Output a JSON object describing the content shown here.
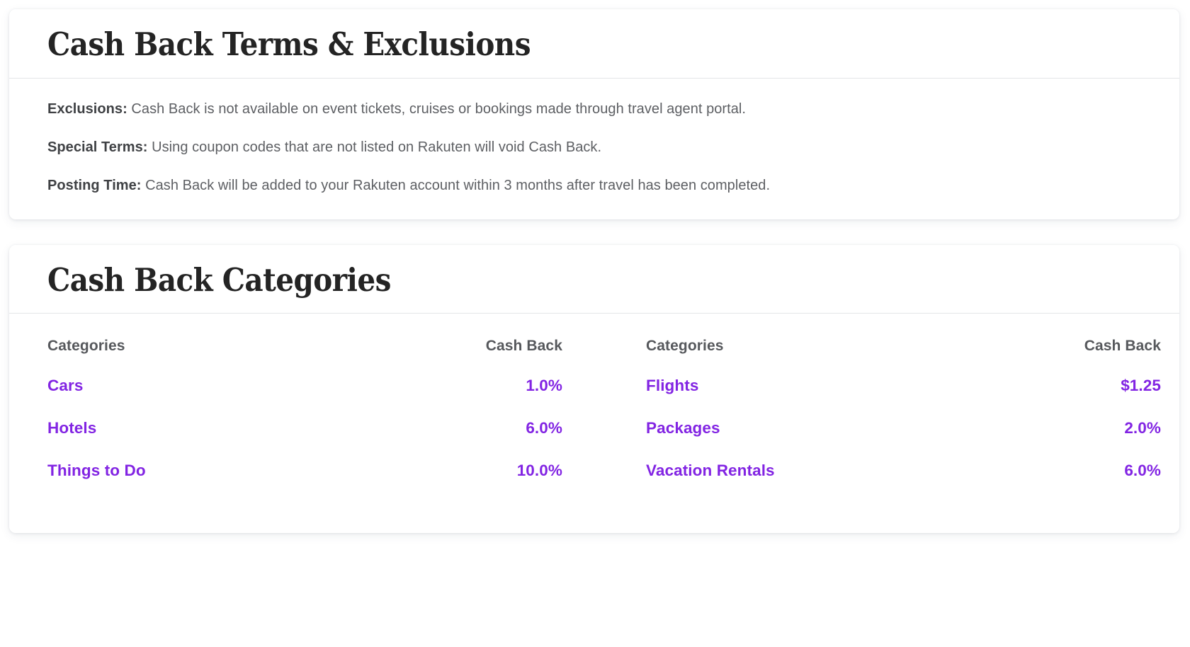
{
  "colors": {
    "accent_purple": "#8224E3",
    "heading_dark": "#242424",
    "body_gray": "#5D5F63",
    "label_gray": "#3F4144",
    "table_header_gray": "#56585C",
    "divider": "#E4E5E8",
    "card_bg": "#FFFFFF",
    "page_bg": "#FFFFFF"
  },
  "terms_card": {
    "title": "Cash Back Terms & Exclusions",
    "lines": [
      {
        "label": "Exclusions:",
        "text": " Cash Back is not available on event tickets, cruises or bookings made through travel agent portal."
      },
      {
        "label": "Special Terms:",
        "text": " Using coupon codes that are not listed on Rakuten will void Cash Back."
      },
      {
        "label": "Posting Time:",
        "text": " Cash Back will be added to your Rakuten account within 3 months after travel has been completed."
      }
    ]
  },
  "categories_card": {
    "title": "Cash Back Categories",
    "tables": [
      {
        "headers": {
          "category": "Categories",
          "cash_back": "Cash Back"
        },
        "rows": [
          {
            "category": "Cars",
            "cash_back": "1.0%"
          },
          {
            "category": "Hotels",
            "cash_back": "6.0%"
          },
          {
            "category": "Things to Do",
            "cash_back": "10.0%"
          }
        ]
      },
      {
        "headers": {
          "category": "Categories",
          "cash_back": "Cash Back"
        },
        "rows": [
          {
            "category": "Flights",
            "cash_back": "$1.25"
          },
          {
            "category": "Packages",
            "cash_back": "2.0%"
          },
          {
            "category": "Vacation Rentals",
            "cash_back": "6.0%"
          }
        ]
      }
    ]
  }
}
